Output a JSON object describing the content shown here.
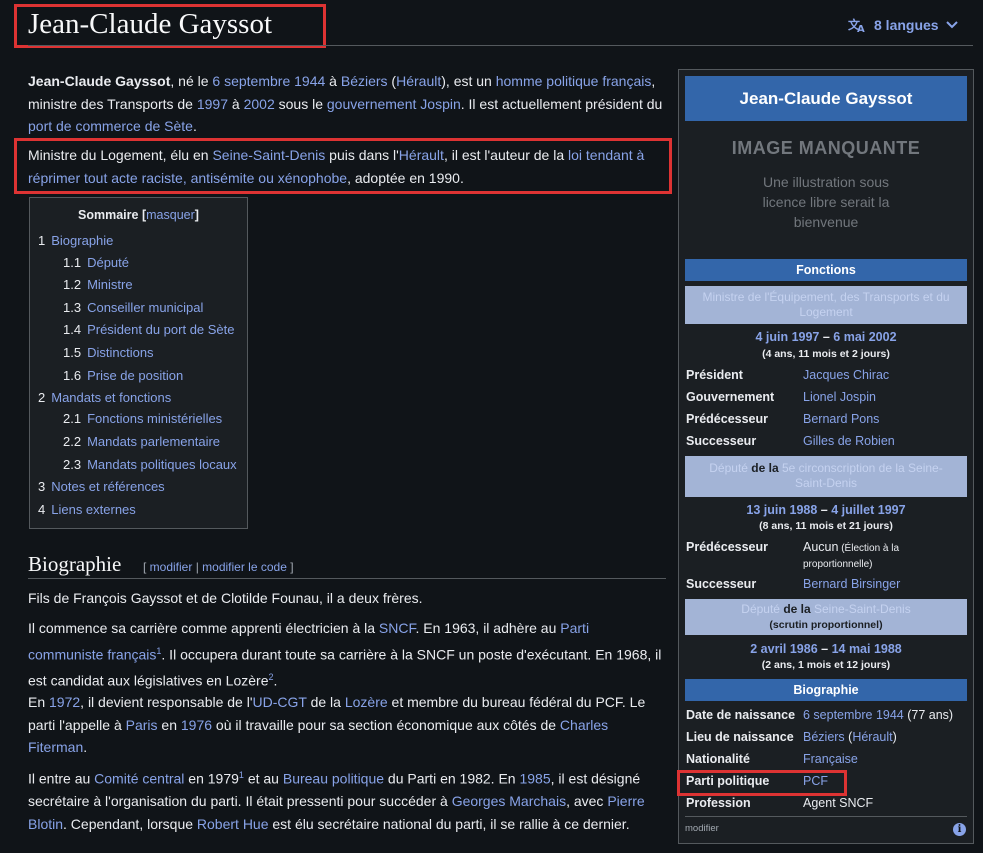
{
  "page": {
    "title": "Jean-Claude Gayssot",
    "languages": "8 langues"
  },
  "intro": {
    "p1": {
      "bold": "Jean-Claude Gayssot",
      "t1": ", né le ",
      "l_date": "6 septembre 1944",
      "t2": " à ",
      "l_beziers": "Béziers",
      "t3": " (",
      "l_herault": "Hérault",
      "t4": "), est un ",
      "l_homme": "homme politique français",
      "t5": ", ministre des Transports de ",
      "l_1997": "1997",
      "t6": " à ",
      "l_2002": "2002",
      "t7": " sous le ",
      "l_gouv": "gouvernement Jospin",
      "t8": ". Il est actuellement président du ",
      "l_port": "port de commerce de Sète",
      "t9": "."
    },
    "p2": {
      "t1": "Ministre du Logement, élu en ",
      "l_ssd": "Seine-Saint-Denis",
      "t2": " puis dans l'",
      "l_herault": "Hérault",
      "t3": ", il est l'auteur de la ",
      "l_loi": "loi tendant à réprimer tout acte raciste, antisémite ou xénophobe",
      "t4": ", adoptée en 1990."
    }
  },
  "toc": {
    "title": "Sommaire",
    "toggle_open": "[",
    "toggle": "masquer",
    "toggle_close": "]",
    "items": [
      {
        "num": "1",
        "label": "Biographie"
      },
      {
        "num": "1.1",
        "label": "Député"
      },
      {
        "num": "1.2",
        "label": "Ministre"
      },
      {
        "num": "1.3",
        "label": "Conseiller municipal"
      },
      {
        "num": "1.4",
        "label": "Président du port de Sète"
      },
      {
        "num": "1.5",
        "label": "Distinctions"
      },
      {
        "num": "1.6",
        "label": "Prise de position"
      },
      {
        "num": "2",
        "label": "Mandats et fonctions"
      },
      {
        "num": "2.1",
        "label": "Fonctions ministérielles"
      },
      {
        "num": "2.2",
        "label": "Mandats parlementaire"
      },
      {
        "num": "2.3",
        "label": "Mandats politiques locaux"
      },
      {
        "num": "3",
        "label": "Notes et références"
      },
      {
        "num": "4",
        "label": "Liens externes"
      }
    ]
  },
  "bio": {
    "heading": "Biographie",
    "edit_open": "[ ",
    "edit": "modifier",
    "edit_sep": " | ",
    "edit_code": "modifier le code",
    "edit_close": " ]",
    "p1": "Fils de François Gayssot et de Clotilde Founau, il a deux frères.",
    "p2": {
      "t1": "Il commence sa carrière comme apprenti électricien à la ",
      "l_sncf": "SNCF",
      "t2": ". En 1963, il adhère au ",
      "l_pcf": "Parti communiste français",
      "sup1": "1",
      "t3": ". Il occupera durant toute sa carrière à la SNCF un poste d'exécutant. En 1968, il est candidat aux législatives en Lozère",
      "sup2": "2",
      "t4": "."
    },
    "p3": {
      "t0": "En ",
      "l_1972": "1972",
      "t1": ", il devient responsable de l'",
      "l_udcgt": "UD-CGT",
      "t2": " de la ",
      "l_lozere": "Lozère",
      "t3": " et membre du bureau fédéral du PCF. Le parti l'appelle à ",
      "l_paris": "Paris",
      "t4": " en ",
      "l_1976": "1976",
      "t5": " où il travaille pour sa section économique aux côtés de ",
      "l_fiterman": "Charles Fiterman",
      "t6": "."
    },
    "p4": {
      "t0": "Il entre au ",
      "l_cc": "Comité central",
      "t1": " en 1979",
      "sup1": "1",
      "t2": " et au ",
      "l_bp": "Bureau politique",
      "t3": " du Parti en 1982. En ",
      "l_1985": "1985",
      "t4": ", il est désigné secrétaire à l'organisation du parti. Il était pressenti pour succéder à ",
      "l_marchais": "Georges Marchais",
      "t5": ", avec ",
      "l_blotin": "Pierre Blotin",
      "t6": ". Cependant, lorsque ",
      "l_hue": "Robert Hue",
      "t7": " est élu secrétaire national du parti, il se rallie à ce dernier."
    }
  },
  "infobox": {
    "name": "Jean-Claude Gayssot",
    "noimage": "IMAGE MANQUANTE",
    "noimage_sub": "Une illustration sous licence libre serait la bienvenue",
    "fonctions": "Fonctions",
    "role1": "Ministre de l'Équipement, des Transports et du Logement",
    "role1_dates": {
      "start": "4 juin 1997",
      "sep": " – ",
      "end": "6 mai 2002"
    },
    "role1_dur": "(4 ans, 11 mois et 2 jours)",
    "role1_rows": [
      {
        "label": "Président",
        "value": "Jacques Chirac"
      },
      {
        "label": "Gouvernement",
        "value": "Lionel Jospin"
      },
      {
        "label": "Prédécesseur",
        "value": "Bernard Pons"
      },
      {
        "label": "Successeur",
        "value": "Gilles de Robien"
      }
    ],
    "role2": {
      "a": "Député",
      "b": " de la ",
      "c": "5e circonscription de la Seine-Saint-Denis"
    },
    "role2_dates": {
      "start": "13 juin 1988",
      "sep": " – ",
      "end": "4 juillet 1997"
    },
    "role2_dur": "(8 ans, 11 mois et 21 jours)",
    "role2_pred_label": "Prédécesseur",
    "role2_pred_value": "Aucun",
    "role2_pred_note": " (Élection à la proportionnelle)",
    "role2_succ_label": "Successeur",
    "role2_succ_value": "Bernard Birsinger",
    "role3": {
      "a": "Député",
      "b": " de la ",
      "c": "Seine-Saint-Denis",
      "sub": "(scrutin proportionnel)"
    },
    "role3_dates": {
      "start": "2 avril 1986",
      "sep": " – ",
      "end": "14 mai 1988"
    },
    "role3_dur": "(2 ans, 1 mois et 12 jours)",
    "biographie": "Biographie",
    "bio_rows": {
      "naissance_label": "Date de naissance",
      "naissance_value": "6 septembre 1944",
      "naissance_age": " (77 ans)",
      "lieu_label": "Lieu de naissance",
      "lieu_value": "Béziers",
      "lieu_open": " (",
      "lieu_region": "Hérault",
      "lieu_close": ")",
      "nat_label": "Nationalité",
      "nat_value": "Française",
      "parti_label": "Parti politique",
      "parti_value": "PCF",
      "prof_label": "Profession",
      "prof_value": "Agent SNCF"
    },
    "footer_edit": "modifier",
    "info_glyph": "i"
  }
}
